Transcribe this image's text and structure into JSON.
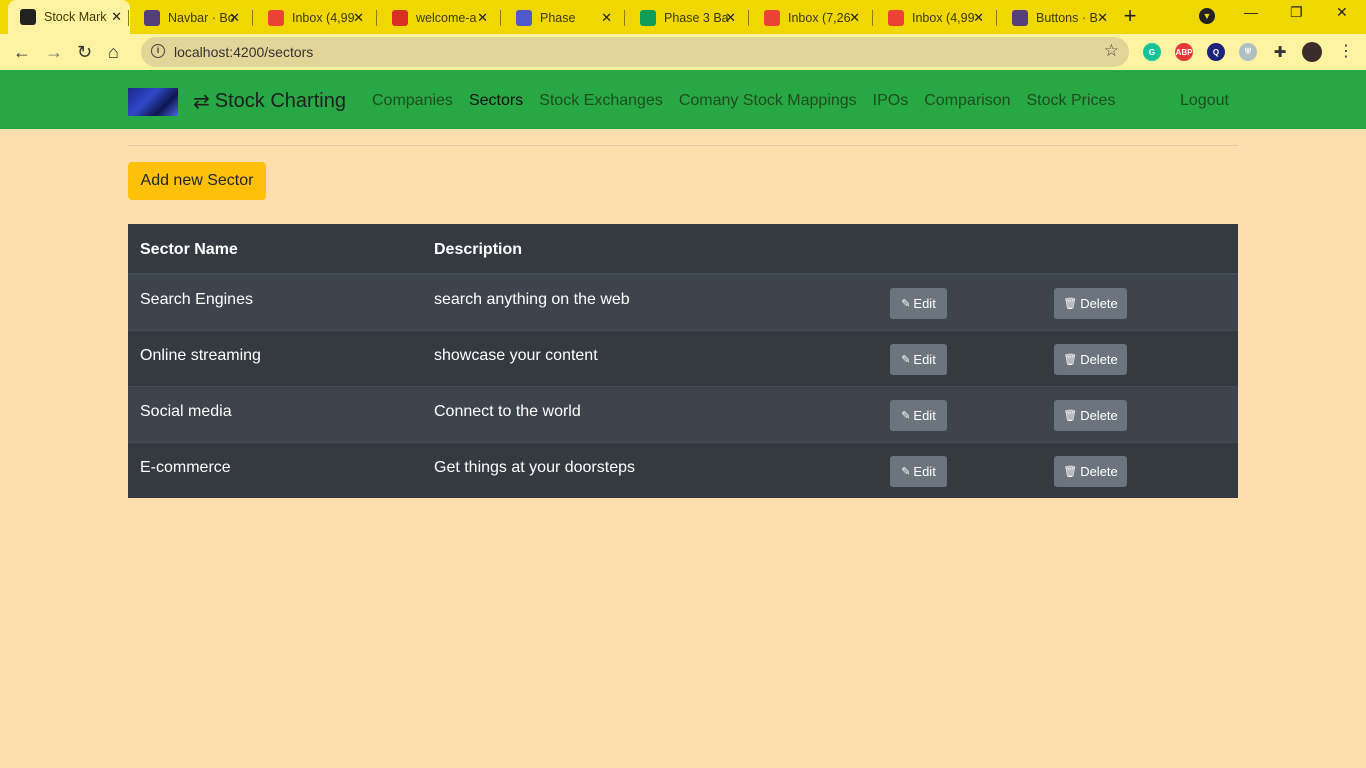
{
  "browser": {
    "tabs": [
      {
        "title": "Stock Mark",
        "icon": "angular-icon",
        "color": "#222222",
        "glyph": "A"
      },
      {
        "title": "Navbar · Bo",
        "icon": "bootstrap-icon",
        "color": "#563d7c",
        "glyph": "B"
      },
      {
        "title": "Inbox (4,99",
        "icon": "gmail-icon",
        "color": "#ea4335",
        "glyph": "M"
      },
      {
        "title": "welcome-a",
        "icon": "calendar-icon",
        "color": "#d93025",
        "glyph": "220"
      },
      {
        "title": "Phase",
        "icon": "teams-icon",
        "color": "#5059c9",
        "glyph": "T"
      },
      {
        "title": "Phase 3 Ba",
        "icon": "sheets-icon",
        "color": "#0f9d58",
        "glyph": "+"
      },
      {
        "title": "Inbox (7,26",
        "icon": "gmail-icon",
        "color": "#ea4335",
        "glyph": "M"
      },
      {
        "title": "Inbox (4,99",
        "icon": "gmail-icon",
        "color": "#ea4335",
        "glyph": "M"
      },
      {
        "title": "Buttons · B",
        "icon": "bootstrap-icon",
        "color": "#563d7c",
        "glyph": "B"
      }
    ],
    "url": "localhost:4200/sectors"
  },
  "nav": {
    "brand": "Stock Charting",
    "links": [
      "Companies",
      "Sectors",
      "Stock Exchanges",
      "Comany Stock Mappings",
      "IPOs",
      "Comparison",
      "Stock Prices"
    ],
    "active": "Sectors",
    "logout": "Logout"
  },
  "page": {
    "add_button": "Add new Sector",
    "headers": {
      "name": "Sector Name",
      "description": "Description"
    },
    "edit_label": "Edit",
    "delete_label": "Delete",
    "rows": [
      {
        "name": "Search Engines",
        "description": "search anything on the web"
      },
      {
        "name": "Online streaming",
        "description": "showcase your content"
      },
      {
        "name": "Social media",
        "description": "Connect to the world"
      },
      {
        "name": "E-commerce",
        "description": "Get things at your doorsteps"
      }
    ]
  },
  "colors": {
    "navbar": "#28a745",
    "page_bg": "#ffdead",
    "add_button": "#ffc107",
    "table": "#343a40",
    "action_button": "#6c757d"
  }
}
